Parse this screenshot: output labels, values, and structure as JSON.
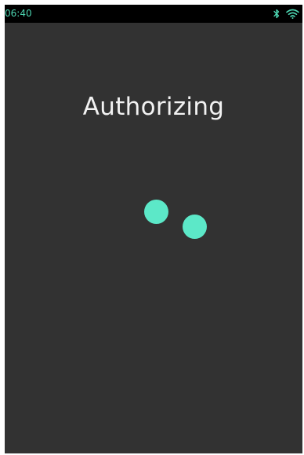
{
  "status_bar": {
    "time": "06:40",
    "bluetooth_icon": "bluetooth-icon",
    "wifi_icon": "wifi-icon",
    "time_color": "#4dd6b2",
    "icon_color": "#4dd6b2"
  },
  "main": {
    "title": "Authorizing",
    "spinner_color": "#5ce8c8",
    "background_color": "#323232"
  }
}
